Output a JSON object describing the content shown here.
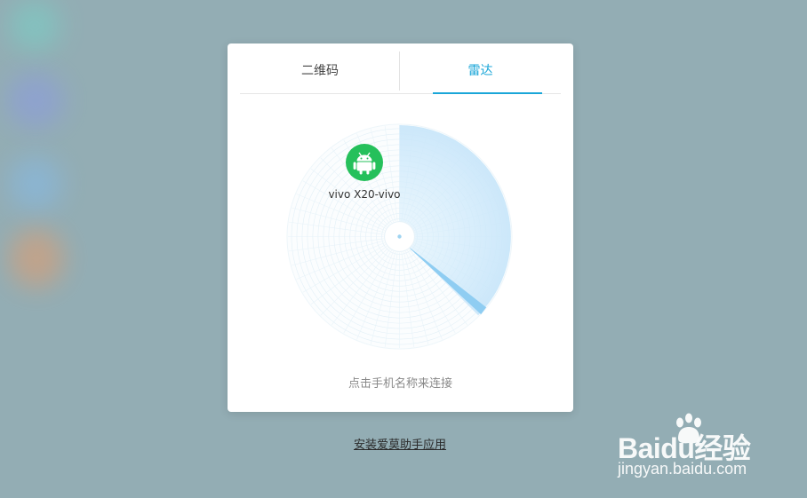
{
  "tabs": [
    {
      "label": "二维码",
      "active": false
    },
    {
      "label": "雷达",
      "active": true
    }
  ],
  "radar": {
    "devices": [
      {
        "name": "vivo X20-vivo",
        "icon": "android-icon"
      }
    ]
  },
  "hint": "点击手机名称来连接",
  "install_link": "安装爱莫助手应用",
  "watermark": {
    "title": "Baidu经验",
    "url": "jingyan.baidu.com"
  },
  "colors": {
    "accent": "#1aa6d8",
    "android_green": "#25c05b",
    "background": "#93adb4"
  }
}
